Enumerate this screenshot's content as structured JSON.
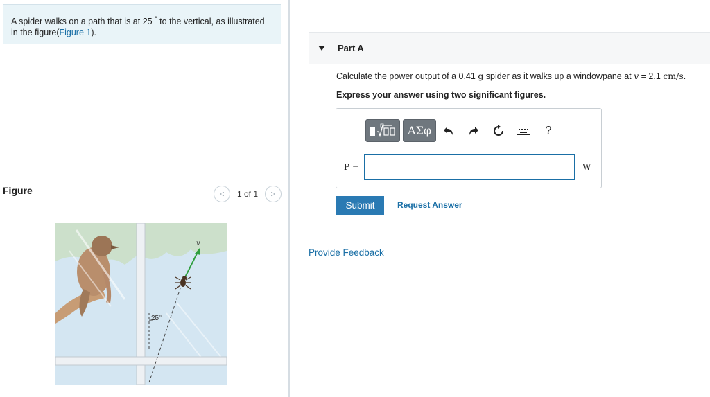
{
  "intro": {
    "text_before": "A spider walks on a path that is at 25",
    "degree_symbol": "°",
    "text_after": " to the vertical, as illustrated in the figure(",
    "figure_link": "Figure 1",
    "text_end": ")."
  },
  "figure": {
    "title": "Figure",
    "pager_prev": "<",
    "pager_text": "1 of 1",
    "pager_next": ">",
    "angle_label": "25°",
    "velocity_label": "v"
  },
  "part": {
    "title": "Part A"
  },
  "question": {
    "prefix": "Calculate the power output of a 0.41 ",
    "mass_unit": "g",
    "middle": " spider as it walks up a windowpane at ",
    "velocity_symbol": "v",
    "value": " = 2.1 ",
    "velocity_unit": "cm/s",
    "suffix": "."
  },
  "instruction": "Express your answer using two significant figures.",
  "toolbar": {
    "greek_label": "ΑΣφ",
    "help_label": "?"
  },
  "answer": {
    "label": "P =",
    "value": "",
    "unit": "W"
  },
  "actions": {
    "submit_label": "Submit",
    "request_answer_label": "Request Answer",
    "feedback_label": "Provide Feedback"
  },
  "colors": {
    "accent": "#2a7ab3",
    "link": "#1a6fa6",
    "intro_bg": "#e9f4f8",
    "toolbar_btn": "#6f777e",
    "arrow_green": "#2e9e3e"
  }
}
